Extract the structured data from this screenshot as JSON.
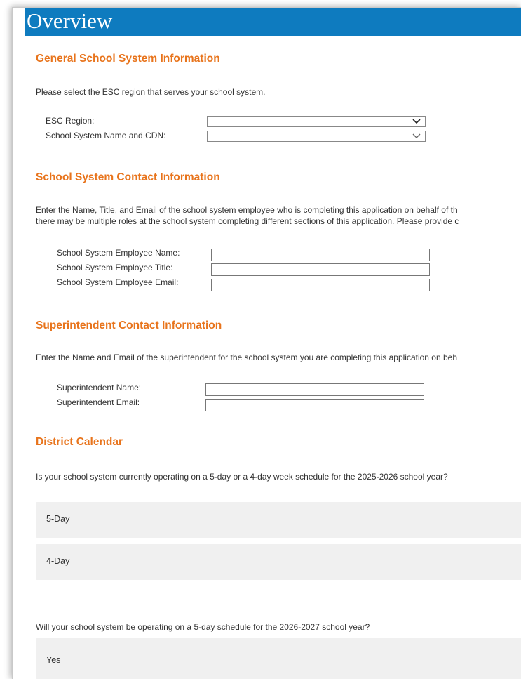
{
  "header": {
    "title": "Overview"
  },
  "general": {
    "title": "General School System Information",
    "instructions": "Please select the ESC region that serves your school system.",
    "esc_region_label": "ESC Region:",
    "esc_region_value": "",
    "system_name_label": "School System Name and CDN:",
    "system_name_value": ""
  },
  "contact": {
    "title": "School System Contact Information",
    "instructions_line1": "Enter the Name, Title, and Email of the school system employee who is completing this application on behalf of th",
    "instructions_line2": "there may be multiple roles at the school system completing different sections of this application. Please provide c",
    "employee_name_label": "School System Employee Name:",
    "employee_title_label": "School System Employee Title:",
    "employee_email_label": "School System Employee Email:",
    "employee_name_value": "",
    "employee_title_value": "",
    "employee_email_value": ""
  },
  "superintendent": {
    "title": "Superintendent Contact Information",
    "instructions": "Enter the Name and Email of the superintendent for the school system you are completing this application on beh",
    "name_label": "Superintendent Name:",
    "email_label": "Superintendent Email:",
    "name_value": "",
    "email_value": ""
  },
  "calendar": {
    "title": "District Calendar",
    "question1": "Is your school system currently operating on a 5-day or a 4-day week schedule for the 2025-2026 school year?",
    "q1_options": [
      "5-Day",
      "4-Day"
    ],
    "question2": "Will your school system be operating on a 5-day schedule for the 2026-2027 school year?",
    "q2_options": [
      "Yes"
    ]
  },
  "icons": {
    "dropdown": "chevron-down-icon"
  },
  "colors": {
    "banner": "#0e7bbf",
    "section_title": "#e8741c",
    "option_bg": "#f0f0f0"
  }
}
